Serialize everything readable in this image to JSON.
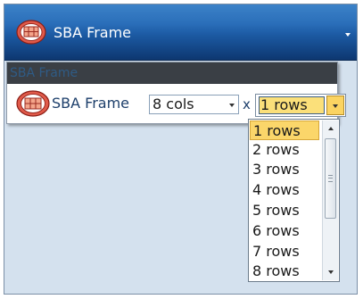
{
  "window": {
    "title": "SBA Frame"
  },
  "panel": {
    "header": "SBA Frame",
    "label": "SBA Frame",
    "times": "x",
    "cols_value": "8 cols",
    "rows_value": "1 rows"
  },
  "dropdown": {
    "selected": "1 rows",
    "items": [
      "1 rows",
      "2 rows",
      "3 rows",
      "4 rows",
      "5 rows",
      "6 rows",
      "7 rows",
      "8 rows"
    ]
  },
  "colors": {
    "title_bar": "#1c5aa3",
    "content_bg": "#d4e1ee",
    "highlight": "#fbd66a",
    "panel_header": "#3a3f45"
  },
  "icons": {
    "app_icon": "sba-frame-icon",
    "dropdown_arrow": "chevron-down-icon",
    "scroll_up": "chevron-up-icon",
    "scroll_down": "chevron-down-icon"
  }
}
